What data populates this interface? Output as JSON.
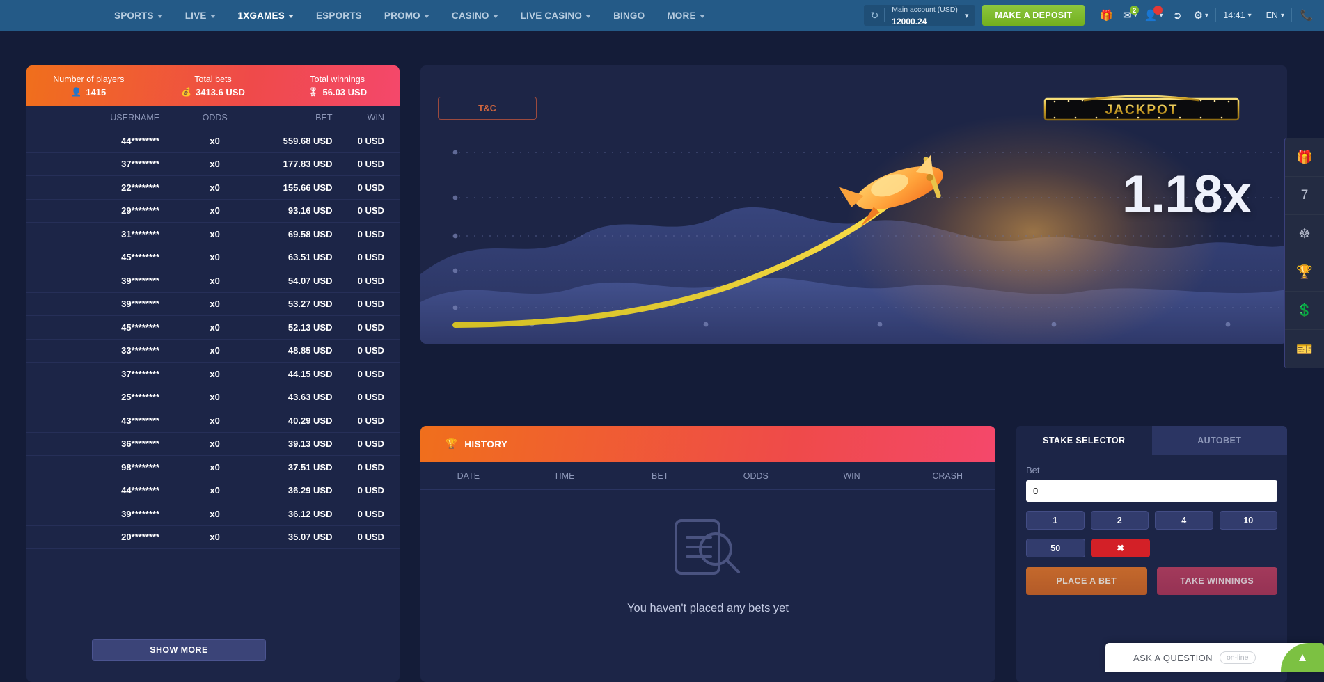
{
  "nav": {
    "items": [
      {
        "label": "SPORTS",
        "caret": true,
        "active": false
      },
      {
        "label": "LIVE",
        "caret": true,
        "active": false
      },
      {
        "label": "1XGAMES",
        "caret": true,
        "active": true
      },
      {
        "label": "ESPORTS",
        "caret": false,
        "active": false
      },
      {
        "label": "PROMO",
        "caret": true,
        "active": false
      },
      {
        "label": "CASINO",
        "caret": true,
        "active": false
      },
      {
        "label": "LIVE CASINO",
        "caret": true,
        "active": false
      },
      {
        "label": "BINGO",
        "caret": false,
        "active": false
      },
      {
        "label": "MORE",
        "caret": true,
        "active": false
      }
    ],
    "account": {
      "label": "Main account (USD)",
      "balance": "12000.24",
      "refresh_icon": "refresh-icon"
    },
    "deposit_label": "MAKE A DEPOSIT",
    "icons": [
      {
        "name": "gift-icon",
        "glyph": "🎁",
        "badge": null
      },
      {
        "name": "mail-icon",
        "glyph": "✉",
        "badge": "2",
        "badge_color": "green",
        "caret": true
      },
      {
        "name": "user-icon",
        "glyph": "👤",
        "badge": "",
        "badge_color": "red",
        "caret": true
      },
      {
        "name": "logout-icon",
        "glyph": "➡",
        "badge": null
      },
      {
        "name": "settings-gear-icon",
        "glyph": "⚙",
        "badge": null,
        "caret": true
      }
    ],
    "clock": "14:41",
    "language": "EN",
    "phone_icon": "phone-icon",
    "accent_green": "#7fba2a",
    "nav_bg": "#245a87"
  },
  "stats": {
    "players_label": "Number of players",
    "players_value": "1415",
    "bets_label": "Total bets",
    "bets_value": "3413.6 USD",
    "winnings_label": "Total winnings",
    "winnings_value": "56.03 USD"
  },
  "players_table": {
    "columns": [
      "USERNAME",
      "ODDS",
      "BET",
      "WIN"
    ],
    "rows": [
      {
        "user": "44********",
        "odds": "x0",
        "bet": "559.68 USD",
        "win": "0 USD"
      },
      {
        "user": "37********",
        "odds": "x0",
        "bet": "177.83 USD",
        "win": "0 USD"
      },
      {
        "user": "22********",
        "odds": "x0",
        "bet": "155.66 USD",
        "win": "0 USD"
      },
      {
        "user": "29********",
        "odds": "x0",
        "bet": "93.16 USD",
        "win": "0 USD"
      },
      {
        "user": "31********",
        "odds": "x0",
        "bet": "69.58 USD",
        "win": "0 USD"
      },
      {
        "user": "45********",
        "odds": "x0",
        "bet": "63.51 USD",
        "win": "0 USD"
      },
      {
        "user": "39********",
        "odds": "x0",
        "bet": "54.07 USD",
        "win": "0 USD"
      },
      {
        "user": "39********",
        "odds": "x0",
        "bet": "53.27 USD",
        "win": "0 USD"
      },
      {
        "user": "45********",
        "odds": "x0",
        "bet": "52.13 USD",
        "win": "0 USD"
      },
      {
        "user": "33********",
        "odds": "x0",
        "bet": "48.85 USD",
        "win": "0 USD"
      },
      {
        "user": "37********",
        "odds": "x0",
        "bet": "44.15 USD",
        "win": "0 USD"
      },
      {
        "user": "25********",
        "odds": "x0",
        "bet": "43.63 USD",
        "win": "0 USD"
      },
      {
        "user": "43********",
        "odds": "x0",
        "bet": "40.29 USD",
        "win": "0 USD"
      },
      {
        "user": "36********",
        "odds": "x0",
        "bet": "39.13 USD",
        "win": "0 USD"
      },
      {
        "user": "98********",
        "odds": "x0",
        "bet": "37.51 USD",
        "win": "0 USD"
      },
      {
        "user": "44********",
        "odds": "x0",
        "bet": "36.29 USD",
        "win": "0 USD"
      },
      {
        "user": "39********",
        "odds": "x0",
        "bet": "36.12 USD",
        "win": "0 USD"
      },
      {
        "user": "20********",
        "odds": "x0",
        "bet": "35.07 USD",
        "win": "0 USD"
      }
    ],
    "show_more_label": "SHOW MORE"
  },
  "game": {
    "tc_label": "T&C",
    "jackpot_label": "JACKPOT",
    "multiplier": "1.18x",
    "plane_icon": "airplane-icon"
  },
  "rail": [
    {
      "name": "gift-icon",
      "glyph": "🎁"
    },
    {
      "name": "lucky-seven-icon",
      "glyph": "7"
    },
    {
      "name": "wheel-of-fortune-icon",
      "glyph": "☸"
    },
    {
      "name": "trophy-icon",
      "glyph": "🏆"
    },
    {
      "name": "money-bag-icon",
      "glyph": "💲"
    },
    {
      "name": "ticket-icon",
      "glyph": "🎫"
    }
  ],
  "history": {
    "title": "HISTORY",
    "title_icon": "trophy-icon",
    "columns": [
      "DATE",
      "TIME",
      "BET",
      "ODDS",
      "WIN",
      "CRASH"
    ],
    "empty_icon": "document-search-icon",
    "empty_text": "You haven't placed any bets yet"
  },
  "stake": {
    "tabs": [
      {
        "label": "STAKE SELECTOR",
        "active": true
      },
      {
        "label": "AUTOBET",
        "active": false
      }
    ],
    "bet_label": "Bet",
    "bet_value": "0",
    "chips_row1": [
      "1",
      "2",
      "4",
      "10"
    ],
    "chips_row2": [
      "50"
    ],
    "clear_icon": "clear-cross-icon",
    "place_bet_label": "PLACE A BET",
    "take_winnings_label": "TAKE WINNINGS"
  },
  "chat": {
    "label": "ASK A QUESTION",
    "status": "on-line",
    "collapse_icon": "chevron-up-icon",
    "accent": "#7cc142"
  }
}
